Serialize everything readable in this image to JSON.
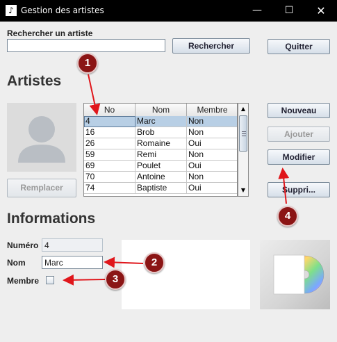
{
  "window": {
    "title": "Gestion des artistes",
    "icon": "music-note-icon"
  },
  "search": {
    "label": "Rechercher un artiste",
    "value": "",
    "button": "Rechercher"
  },
  "quit_button": "Quitter",
  "artists": {
    "heading": "Artistes",
    "replace_button": "Remplacer",
    "columns": [
      "No",
      "Nom",
      "Membre"
    ],
    "rows": [
      {
        "no": "4",
        "nom": "Marc",
        "membre": "Non",
        "selected": true
      },
      {
        "no": "16",
        "nom": "Brob",
        "membre": "Non"
      },
      {
        "no": "26",
        "nom": "Romaine",
        "membre": "Oui"
      },
      {
        "no": "59",
        "nom": "Remi",
        "membre": "Non"
      },
      {
        "no": "69",
        "nom": "Poulet",
        "membre": "Oui"
      },
      {
        "no": "70",
        "nom": "Antoine",
        "membre": "Non"
      },
      {
        "no": "74",
        "nom": "Baptiste",
        "membre": "Oui"
      }
    ]
  },
  "actions": {
    "new": "Nouveau",
    "add": "Ajouter",
    "modify": "Modifier",
    "delete": "Suppri..."
  },
  "info": {
    "heading": "Informations",
    "numero_label": "Numéro",
    "numero_value": "4",
    "nom_label": "Nom",
    "nom_value": "Marc",
    "membre_label": "Membre",
    "membre_checked": false
  },
  "annotations": [
    "1",
    "2",
    "3",
    "4"
  ],
  "colors": {
    "annotation": "#8b1515",
    "selection": "#b8cfe5",
    "arrow": "#e0161b"
  }
}
